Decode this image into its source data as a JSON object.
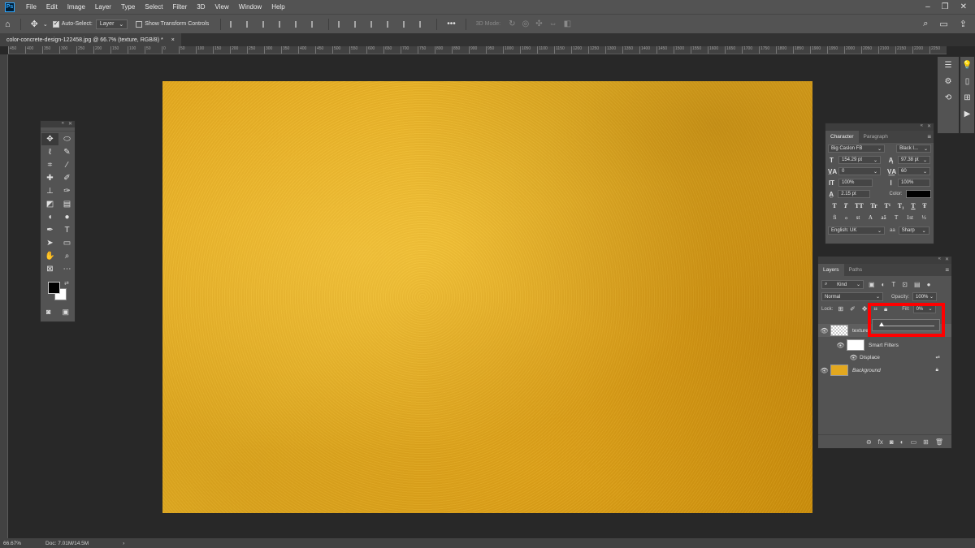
{
  "app": {
    "logo": "Ps"
  },
  "menu": [
    "File",
    "Edit",
    "Image",
    "Layer",
    "Type",
    "Select",
    "Filter",
    "3D",
    "View",
    "Window",
    "Help"
  ],
  "options": {
    "auto_select_label": "Auto-Select:",
    "auto_select_value": "Layer",
    "show_transform_label": "Show Transform Controls",
    "mode_3d_label": "3D Mode:"
  },
  "document": {
    "tab_title": "color-concrete-design-122458.jpg @ 66.7% (texture, RGB/8) *",
    "close_glyph": "×"
  },
  "ruler_top": [
    "450",
    "400",
    "350",
    "300",
    "250",
    "200",
    "150",
    "100",
    "50",
    "0",
    "50",
    "100",
    "150",
    "200",
    "250",
    "300",
    "350",
    "400",
    "450",
    "500",
    "550",
    "600",
    "650",
    "700",
    "750",
    "800",
    "850",
    "900",
    "950",
    "1000",
    "1050",
    "1100",
    "1150",
    "1200",
    "1250",
    "1300",
    "1350",
    "1400",
    "1450",
    "1500",
    "1550",
    "1600",
    "1650",
    "1700",
    "1750",
    "1800",
    "1850",
    "1900",
    "1950",
    "2000",
    "2050",
    "2100",
    "2150",
    "2200",
    "2250"
  ],
  "character": {
    "tabs": [
      "Character",
      "Paragraph"
    ],
    "font_family": "Big Caslon FB",
    "font_style": "Black I...",
    "font_size": "154.29 pt",
    "leading": "97.38 pt",
    "kerning": "0",
    "tracking": "60",
    "vertical_scale": "100%",
    "horizontal_scale": "100%",
    "baseline_shift": "2.15 pt",
    "color_label": "Color:",
    "color_value": "#000000",
    "style_buttons": [
      "T",
      "T",
      "TT",
      "Tr",
      "T¹",
      "T₁",
      "T",
      "Ŧ"
    ],
    "opentype_buttons": [
      "fi",
      "ℴ",
      "st",
      "A",
      "aā",
      "T",
      "1st",
      "½"
    ],
    "language": "English: UK",
    "antialias_label": "aa",
    "antialias": "Sharp"
  },
  "layers": {
    "tabs": [
      "Layers",
      "Paths"
    ],
    "filter_kind": "Kind",
    "blend_mode": "Normal",
    "opacity_label": "Opacity:",
    "opacity_value": "100%",
    "lock_label": "Lock:",
    "fill_label": "Fill:",
    "fill_value": "0%",
    "fill_slider_level": 0,
    "items": [
      {
        "name": "texture",
        "type": "smart-object"
      },
      {
        "name": "Smart Filters",
        "type": "filter-group"
      },
      {
        "name": "Displace",
        "type": "filter"
      },
      {
        "name": "Background",
        "type": "background",
        "locked": true
      }
    ]
  },
  "status": {
    "zoom": "66.67%",
    "doc_info": "Doc: 7.01M/14.5M",
    "arrow": "›"
  },
  "colors": {
    "highlight": "#ff0000",
    "texture_gold": "#e3a81f",
    "foreground": "#000000",
    "background": "#ffffff"
  }
}
